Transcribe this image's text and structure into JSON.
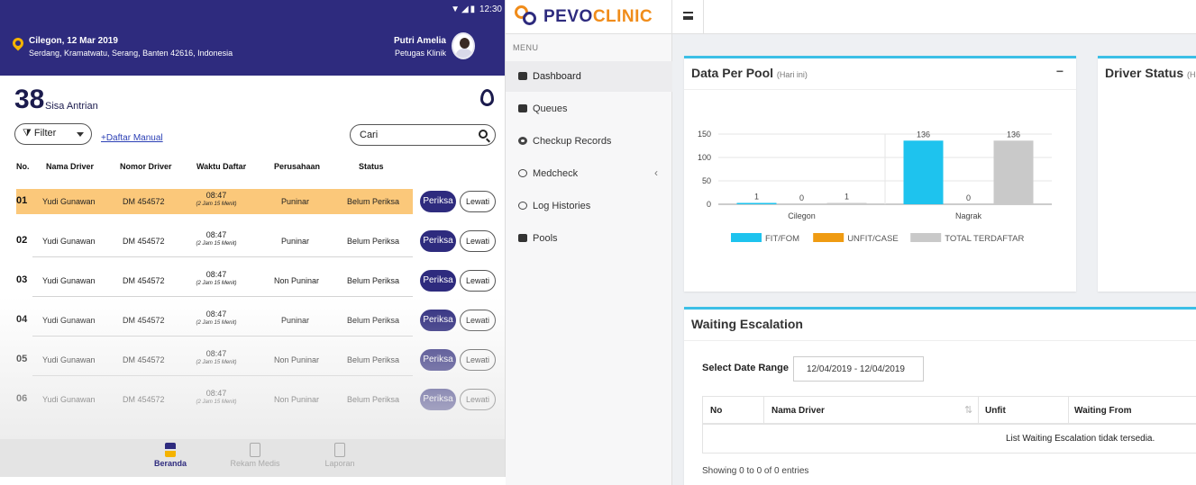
{
  "mobile": {
    "status_time": "12:30",
    "location_date": "Cilegon, 12 Mar 2019",
    "location_address": "Serdang, Kramatwatu, Serang, Banten 42616, Indonesia",
    "user_name": "Putri Amelia",
    "user_role": "Petugas Klinik",
    "queue_count": "38",
    "queue_label": "Sisa Antrian",
    "filter_label": "Filter",
    "manual_link": "+Daftar Manual",
    "search_placeholder": "Cari",
    "columns": [
      "No.",
      "Nama Driver",
      "Nomor Driver",
      "Waktu Daftar",
      "Perusahaan",
      "Status"
    ],
    "rows": [
      {
        "no": "01",
        "name": "Yudi Gunawan",
        "number": "DM 454572",
        "time": "08:47",
        "duration": "(2 Jam 15 Menit)",
        "company": "Puninar",
        "status": "Belum Periksa"
      },
      {
        "no": "02",
        "name": "Yudi Gunawan",
        "number": "DM 454572",
        "time": "08:47",
        "duration": "(2 Jam 15 Menit)",
        "company": "Puninar",
        "status": "Belum Periksa"
      },
      {
        "no": "03",
        "name": "Yudi Gunawan",
        "number": "DM 454572",
        "time": "08:47",
        "duration": "(2 Jam 15 Menit)",
        "company": "Non Puninar",
        "status": "Belum Periksa"
      },
      {
        "no": "04",
        "name": "Yudi Gunawan",
        "number": "DM 454572",
        "time": "08:47",
        "duration": "(2 Jam 15 Menit)",
        "company": "Puninar",
        "status": "Belum Periksa"
      },
      {
        "no": "05",
        "name": "Yudi Gunawan",
        "number": "DM 454572",
        "time": "08:47",
        "duration": "(2 Jam 15 Menit)",
        "company": "Non Puninar",
        "status": "Belum Periksa"
      },
      {
        "no": "06",
        "name": "Yudi Gunawan",
        "number": "DM 454572",
        "time": "08:47",
        "duration": "(2 Jam 15 Menit)",
        "company": "Non Puninar",
        "status": "Belum Periksa"
      }
    ],
    "btn_periksa": "Periksa",
    "btn_lewati": "Lewati",
    "nav": [
      "Beranda",
      "Rekam Medis",
      "Laporan"
    ]
  },
  "web": {
    "brand_part1": "PEVO",
    "brand_part2": "CLINIC",
    "menu_heading": "MENU",
    "menu": [
      "Dashboard",
      "Queues",
      "Checkup Records",
      "Medcheck",
      "Log Histories",
      "Pools"
    ],
    "panel1_title": "Data Per Pool",
    "panel1_subtitle": "(Hari ini)",
    "panel1_minimize": "−",
    "panel2_title": "Driver Status",
    "panel2_subtitle": "(Ha",
    "panel3_title": "Waiting Escalation",
    "date_label": "Select Date Range",
    "date_value": "12/04/2019 - 12/04/2019",
    "table_columns": [
      "No",
      "Nama Driver",
      "Unfit",
      "Waiting From"
    ],
    "table_empty": "List Waiting Escalation tidak tersedia.",
    "showing": "Showing 0 to 0 of 0 entries"
  },
  "colors": {
    "primary": "#2e2b7e",
    "accent_orange": "#f08c1a",
    "panel_top": "#3bbfe6",
    "fit": "#1ec3ee",
    "unfit": "#ef9b12",
    "total": "#c9c9c9"
  },
  "chart_data": {
    "type": "bar",
    "categories": [
      "Cilegon",
      "Nagrak"
    ],
    "series": [
      {
        "name": "FIT/FOM",
        "values": [
          1,
          136
        ]
      },
      {
        "name": "UNFIT/CASE",
        "values": [
          0,
          0
        ]
      },
      {
        "name": "TOTAL TERDAFTAR",
        "values": [
          1,
          136
        ]
      }
    ],
    "yticks": [
      "0",
      "50",
      "100",
      "150"
    ],
    "ylim": [
      0,
      150
    ],
    "legend": "bottom"
  }
}
